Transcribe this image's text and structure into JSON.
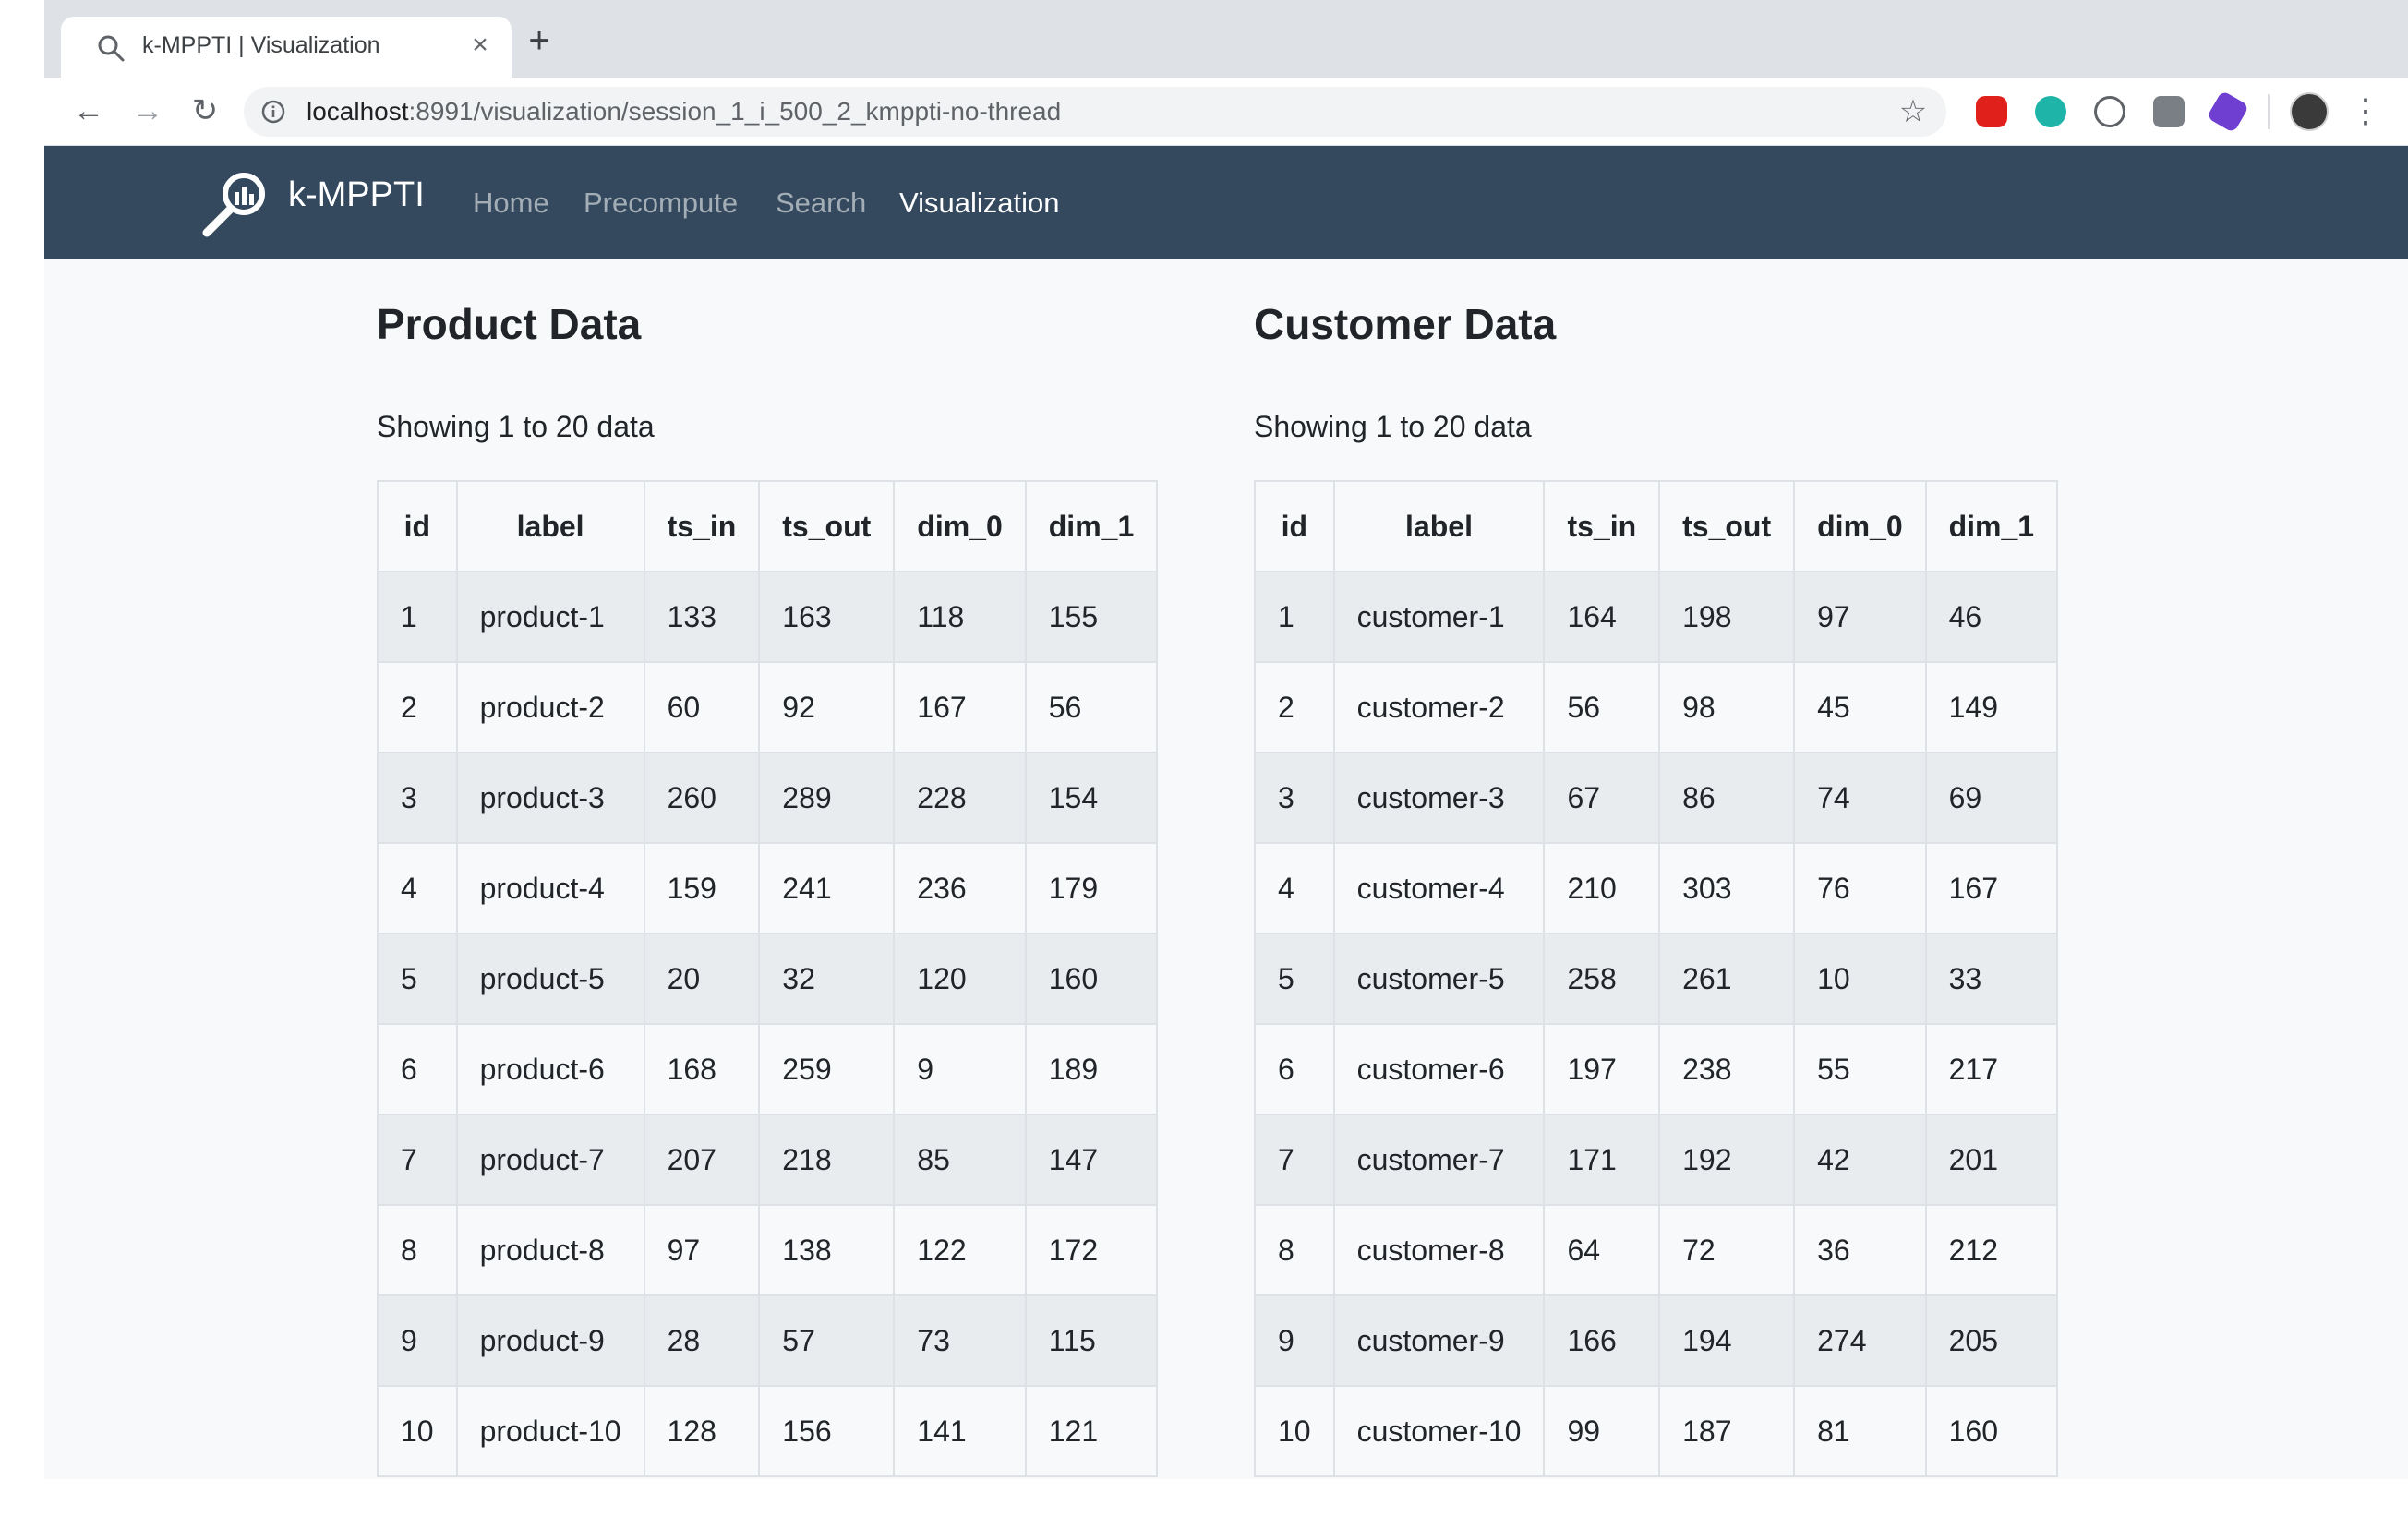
{
  "browser": {
    "tab_title": "k-MPPTI | Visualization",
    "url_host": "localhost",
    "url_path": ":8991/visualization/session_1_i_500_2_kmppti-no-thread"
  },
  "navbar": {
    "brand": "k-MPPTI",
    "links": [
      "Home",
      "Precompute",
      "Search",
      "Visualization"
    ],
    "active": "Visualization"
  },
  "product": {
    "title": "Product Data",
    "showing": "Showing 1 to 20 data",
    "columns": [
      "id",
      "label",
      "ts_in",
      "ts_out",
      "dim_0",
      "dim_1"
    ],
    "rows": [
      [
        "1",
        "product-1",
        "133",
        "163",
        "118",
        "155"
      ],
      [
        "2",
        "product-2",
        "60",
        "92",
        "167",
        "56"
      ],
      [
        "3",
        "product-3",
        "260",
        "289",
        "228",
        "154"
      ],
      [
        "4",
        "product-4",
        "159",
        "241",
        "236",
        "179"
      ],
      [
        "5",
        "product-5",
        "20",
        "32",
        "120",
        "160"
      ],
      [
        "6",
        "product-6",
        "168",
        "259",
        "9",
        "189"
      ],
      [
        "7",
        "product-7",
        "207",
        "218",
        "85",
        "147"
      ],
      [
        "8",
        "product-8",
        "97",
        "138",
        "122",
        "172"
      ],
      [
        "9",
        "product-9",
        "28",
        "57",
        "73",
        "115"
      ],
      [
        "10",
        "product-10",
        "128",
        "156",
        "141",
        "121"
      ]
    ]
  },
  "customer": {
    "title": "Customer Data",
    "showing": "Showing 1 to 20 data",
    "columns": [
      "id",
      "label",
      "ts_in",
      "ts_out",
      "dim_0",
      "dim_1"
    ],
    "rows": [
      [
        "1",
        "customer-1",
        "164",
        "198",
        "97",
        "46"
      ],
      [
        "2",
        "customer-2",
        "56",
        "98",
        "45",
        "149"
      ],
      [
        "3",
        "customer-3",
        "67",
        "86",
        "74",
        "69"
      ],
      [
        "4",
        "customer-4",
        "210",
        "303",
        "76",
        "167"
      ],
      [
        "5",
        "customer-5",
        "258",
        "261",
        "10",
        "33"
      ],
      [
        "6",
        "customer-6",
        "197",
        "238",
        "55",
        "217"
      ],
      [
        "7",
        "customer-7",
        "171",
        "192",
        "42",
        "201"
      ],
      [
        "8",
        "customer-8",
        "64",
        "72",
        "36",
        "212"
      ],
      [
        "9",
        "customer-9",
        "166",
        "194",
        "274",
        "205"
      ],
      [
        "10",
        "customer-10",
        "99",
        "187",
        "81",
        "160"
      ]
    ]
  }
}
